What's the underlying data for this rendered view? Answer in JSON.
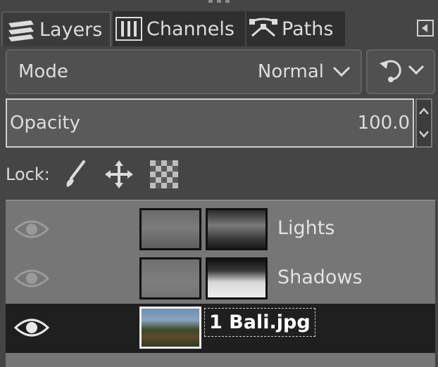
{
  "tabs": [
    {
      "label": "Layers",
      "icon": "layers-icon",
      "active": true
    },
    {
      "label": "Channels",
      "icon": "channels-icon",
      "active": false
    },
    {
      "label": "Paths",
      "icon": "paths-icon",
      "active": false
    }
  ],
  "mode": {
    "label": "Mode",
    "value": "Normal"
  },
  "opacity": {
    "label": "Opacity",
    "value": "100.0"
  },
  "lock": {
    "label": "Lock:",
    "icons": [
      "brush-icon",
      "move-icon",
      "checkerboard-icon"
    ]
  },
  "layers": [
    {
      "name": "Lights",
      "visible": true,
      "selected": false,
      "has_mask": true
    },
    {
      "name": "Shadows",
      "visible": true,
      "selected": false,
      "has_mask": true
    },
    {
      "name": "1 Bali.jpg",
      "visible": true,
      "selected": true,
      "has_mask": false
    }
  ]
}
